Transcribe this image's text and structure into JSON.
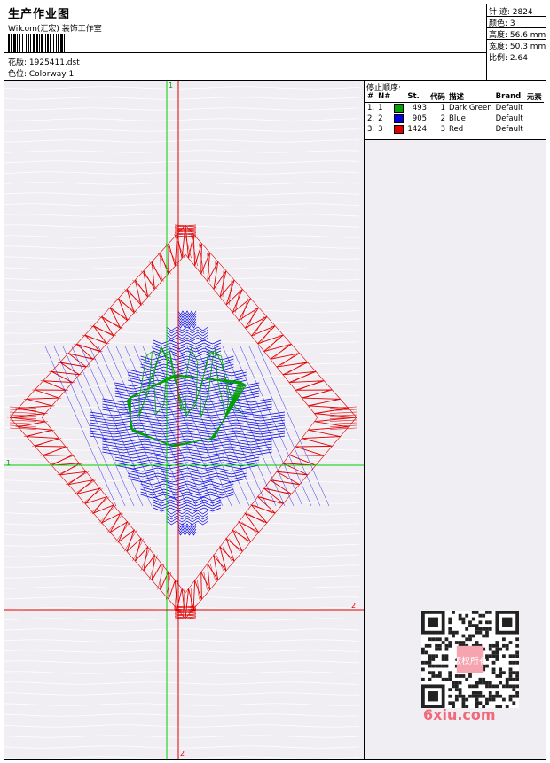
{
  "header": {
    "title": "生产作业图",
    "subtitle": "Wilcom(汇宏) 装饰工作室",
    "pattern_label": "花版: 1925411.dst",
    "colorway_label": "色位: Colorway 1"
  },
  "stats": [
    {
      "label": "针 迹",
      "value": "2824"
    },
    {
      "label": "颜色",
      "value": "3"
    },
    {
      "label": "高度",
      "value": "56.6 mm"
    },
    {
      "label": "宽度",
      "value": "50.3 mm"
    },
    {
      "label": "比例",
      "value": "2.64"
    }
  ],
  "stop_sequence": {
    "title": "停止顺序:",
    "columns": [
      "#",
      "N#",
      "",
      "St.",
      "代码",
      "描述",
      "Brand",
      "元素"
    ],
    "rows": [
      {
        "idx": "1.",
        "n": "1",
        "color": "#00a000",
        "stitches": "493",
        "code": "1",
        "desc": "Dark Green",
        "brand": "Default"
      },
      {
        "idx": "2.",
        "n": "2",
        "color": "#0000e0",
        "stitches": "905",
        "code": "2",
        "desc": "Blue",
        "brand": "Default"
      },
      {
        "idx": "3.",
        "n": "3",
        "color": "#e00000",
        "stitches": "1424",
        "code": "3",
        "desc": "Red",
        "brand": "Default"
      }
    ]
  },
  "axes": {
    "green_top": "1",
    "green_left": "1",
    "red_bottom": "2",
    "red_right": "2"
  },
  "colors": {
    "green": "#00d000",
    "red": "#e00000",
    "blue": "#0000ee",
    "dark_green": "#00a000"
  },
  "watermark": {
    "text": "6xiu.com",
    "seal": "版权所有"
  }
}
